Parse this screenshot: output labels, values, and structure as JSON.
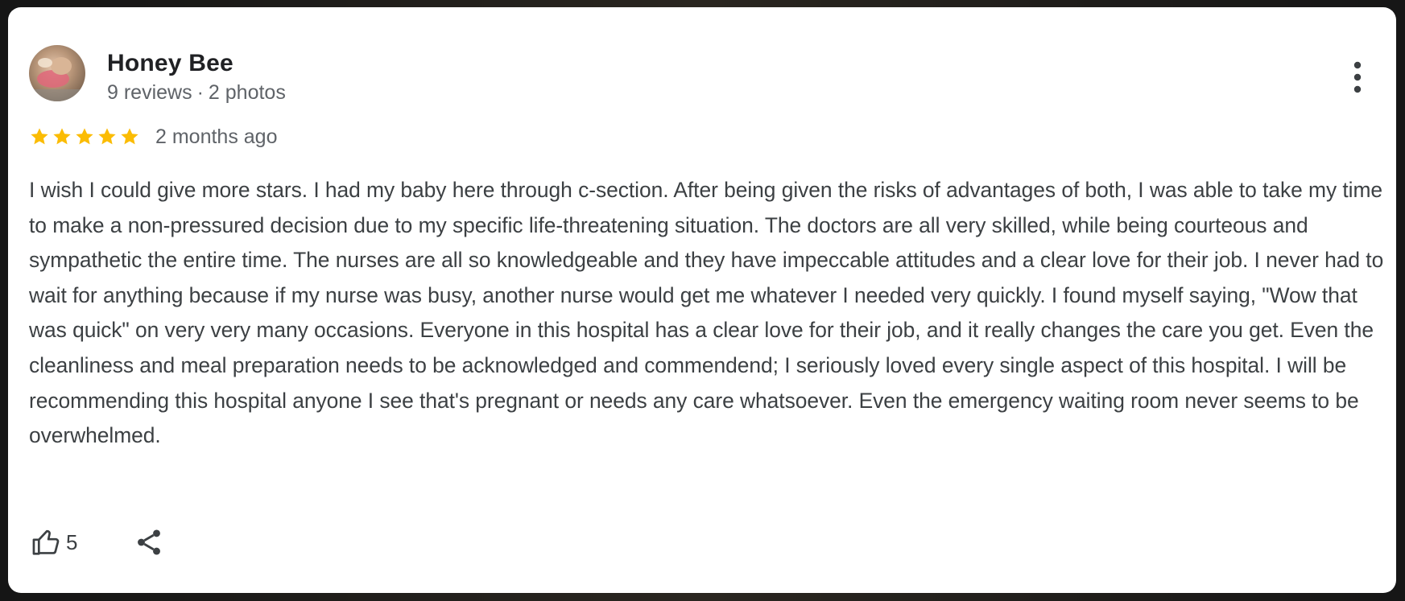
{
  "review": {
    "author": {
      "name": "Honey Bee",
      "reviews_count": "9 reviews",
      "photos_count": "2 photos",
      "separator": "·",
      "avatar_icon": "avatar-photo"
    },
    "rating": {
      "stars": 5,
      "max": 5,
      "star_color": "#fbbc04"
    },
    "age": "2 months ago",
    "text": "I wish I could give more stars. I had my baby here through c-section. After being given the risks of advantages of both, I was able to take my time to make a non-pressured decision due to my specific life-threatening situation. The doctors are all very skilled, while being courteous and sympathetic the entire time. The nurses are all so knowledgeable and they have impeccable attitudes and a clear love for their job. I never had to wait for anything because if my nurse was busy, another nurse would get me whatever I needed very quickly. I found myself saying, \"Wow that was quick\" on very very many occasions. Everyone in this hospital has a clear love for their job, and it really changes the care you get. Even the cleanliness and meal preparation needs to be acknowledged and commendend; I seriously loved every single aspect of this hospital. I will be recommending this hospital anyone I see that's pregnant or needs any care whatsoever. Even the emergency waiting room never seems to be overwhelmed.",
    "actions": {
      "like_count": "5",
      "like_icon": "thumbs-up-icon",
      "share_icon": "share-icon",
      "more_icon": "more-vertical-icon"
    }
  }
}
